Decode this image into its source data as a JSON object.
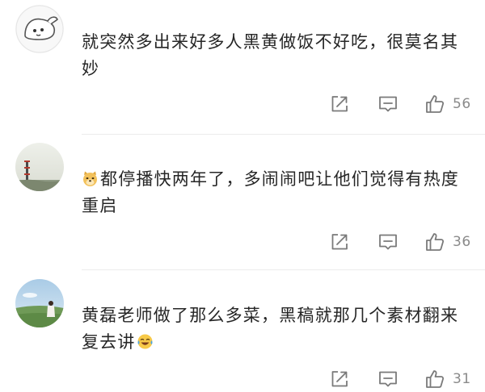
{
  "comments": [
    {
      "lines": [
        "就突然多出来好多人黑黄做饭不好吃，很莫名其",
        "妙"
      ],
      "likes": "56",
      "avatar_icon": "cartoon-face-avatar",
      "prefix_emoji": ""
    },
    {
      "lines": [
        "都停播快两年了，多闹闹吧让他们觉得有热度",
        "重启"
      ],
      "likes": "36",
      "avatar_icon": "landscape-tower-avatar",
      "prefix_emoji": "doge-emoji"
    },
    {
      "lines": [
        "黄磊老师做了那么多菜，黑稿就那几个素材翻来",
        "复去讲"
      ],
      "likes": "31",
      "avatar_icon": "meadow-person-avatar",
      "suffix_emoji": "laugh-cry-emoji"
    }
  ],
  "icons": {
    "share": "share-icon",
    "reply": "comment-icon",
    "like": "thumbs-up-icon"
  },
  "colors": {
    "text": "#262626",
    "icon": "#7a7a7a",
    "count": "#8a8a8a"
  }
}
